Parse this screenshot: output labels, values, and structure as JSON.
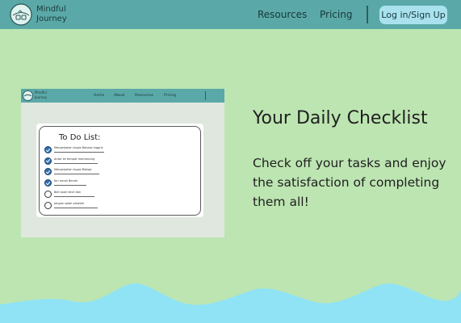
{
  "header": {
    "logo_line1": "Mindful",
    "logo_line2": "Journey",
    "nav": [
      "Resources",
      "Pricing"
    ],
    "login_label": "Log in/Sign Up"
  },
  "preview": {
    "logo_line1": "Mindful",
    "logo_line2": "Journey",
    "nav": [
      "Home",
      "About",
      "Resources",
      "Pricing"
    ],
    "todo_title": "To Do List:",
    "items": [
      {
        "text": "Mengerjakan tugas Bahasa Inggris",
        "done": true
      },
      {
        "text": "Antar ke tempat memancing",
        "done": true
      },
      {
        "text": "Mengerjakan tugas Biologi",
        "done": true
      },
      {
        "text": "Ke rumah Benah",
        "done": true
      },
      {
        "text": "Beli buah kecil dan",
        "done": false
      },
      {
        "text": "Jangan salah sebelah",
        "done": false
      }
    ]
  },
  "main": {
    "heading": "Your Daily Checklist",
    "body": "Check off your tasks and enjoy the satisfaction of completing them all!"
  },
  "colors": {
    "page_bg": "#bde5b2",
    "header_bg": "#5aa9a8",
    "login_bg": "#a9e2ee",
    "wave": "#8fe3f5"
  }
}
